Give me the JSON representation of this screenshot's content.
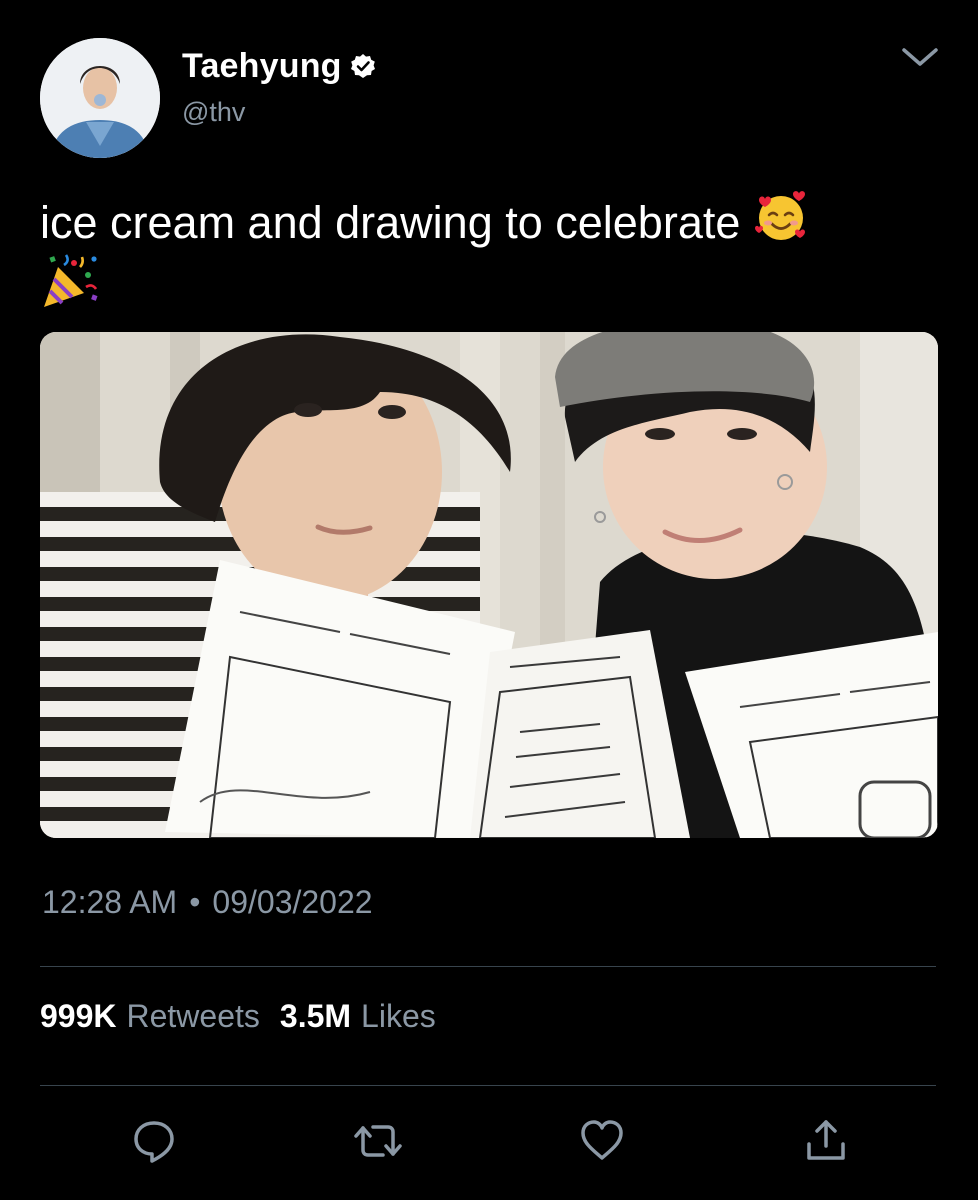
{
  "user": {
    "display_name": "Taehyung",
    "handle": "@thv",
    "verified": true,
    "avatar_icon": "profile-photo"
  },
  "tweet": {
    "text": "ice cream and drawing to celebrate",
    "emojis": [
      "smiling-face-with-hearts",
      "party-popper"
    ],
    "time": "12:28 AM",
    "separator": "•",
    "date": "09/03/2022"
  },
  "stats": {
    "retweets_count": "999K",
    "retweets_label": "Retweets",
    "likes_count": "3.5M",
    "likes_label": "Likes"
  },
  "actions": [
    "reply-icon",
    "retweet-icon",
    "like-icon",
    "share-icon"
  ],
  "colors": {
    "background": "#000000",
    "text": "#ffffff",
    "secondary_text": "#8b98a5",
    "divider": "#38444d"
  }
}
